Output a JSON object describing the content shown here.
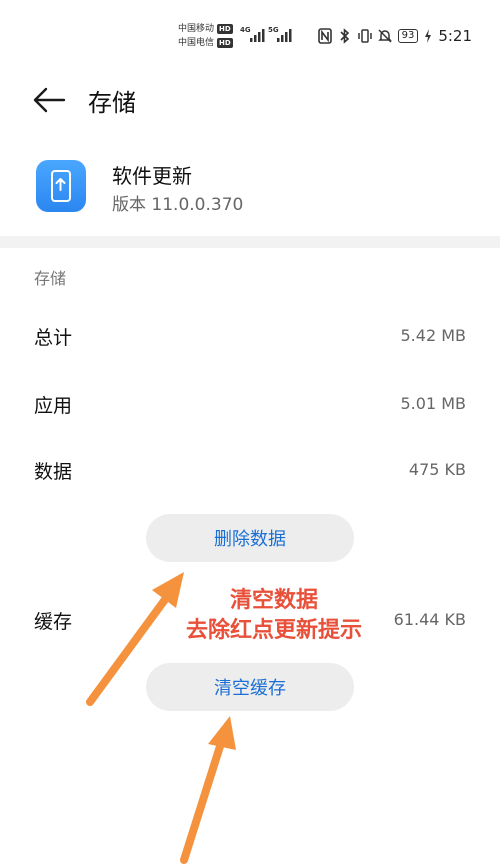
{
  "status_bar": {
    "carrier1": "中国移动",
    "carrier2": "中国电信",
    "hd_badge": "HD",
    "net1": "4G",
    "net2": "5G",
    "battery": "93",
    "time": "5:21"
  },
  "header": {
    "title": "存储"
  },
  "app": {
    "name": "软件更新",
    "version": "版本 11.0.0.370"
  },
  "storage": {
    "section_label": "存储",
    "rows": [
      {
        "label": "总计",
        "value": "5.42 MB"
      },
      {
        "label": "应用",
        "value": "5.01 MB"
      },
      {
        "label": "数据",
        "value": "475 KB"
      }
    ],
    "cache_label": "缓存",
    "cache_value": "61.44 KB"
  },
  "buttons": {
    "delete_data": "删除数据",
    "clear_cache": "清空缓存"
  },
  "annotation": {
    "line1": "清空数据",
    "line2": "去除红点更新提示",
    "color": "#e8503a",
    "arrow_color": "#f5923e"
  }
}
